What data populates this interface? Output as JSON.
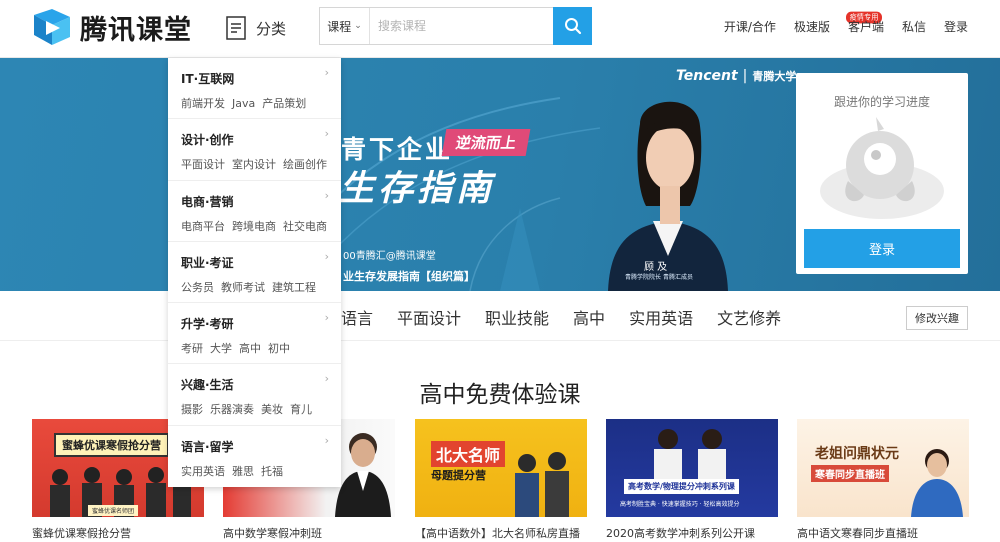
{
  "header": {
    "logo_text": "腾讯课堂",
    "category_label": "分类",
    "search": {
      "type_label": "课程",
      "placeholder": "搜索课程"
    },
    "nav": [
      "开课/合作",
      "极速版",
      "客户端",
      "私信",
      "登录"
    ],
    "nav_badge": "疫情专用"
  },
  "banner": {
    "title_part1": "青下企业",
    "tag": "逆流而上",
    "title_part2": "生存指南",
    "sub1": "00青腾汇@腾讯课堂",
    "sub2": "业生存发展指南【组织篇】",
    "brand": "Tencent",
    "brand_sub": "青腾大学",
    "speaker_name": "顾 及",
    "speaker_title": "青腾学院院长 青腾汇成员"
  },
  "progress": {
    "text": "跟进你的学习进度",
    "login_label": "登录"
  },
  "subjects": [
    "语言",
    "平面设计",
    "职业技能",
    "高中",
    "实用英语",
    "文艺修养"
  ],
  "modify_label": "修改兴趣",
  "section_title": "高中免费体验课",
  "courses": [
    {
      "caption": "蜜蜂优课寒假抢分营",
      "thumb_text": "蜜蜂优课寒假抢分营",
      "thumb_sub": "蜜蜂优课名师团"
    },
    {
      "caption": "高中数学寒假冲刺班",
      "thumb_text": "",
      "thumb_sub": ""
    },
    {
      "caption": "【高中语数外】北大名师私房直播",
      "thumb_text": "北大名师",
      "thumb_sub": "母题提分营"
    },
    {
      "caption": "2020高考数学冲刺系列公开课",
      "thumb_text": "高考数学/物理提分冲刺系列课",
      "thumb_sub": "高考制胜宝典 · 快速掌握技巧 · 轻松高效提分"
    },
    {
      "caption": "高中语文寒春同步直播班",
      "thumb_text": "老姐问鼎状元",
      "thumb_sub": "寒春同步直播班"
    }
  ],
  "dropdown": [
    {
      "title": "IT·互联网",
      "items": [
        "前端开发",
        "Java",
        "产品策划"
      ]
    },
    {
      "title": "设计·创作",
      "items": [
        "平面设计",
        "室内设计",
        "绘画创作"
      ]
    },
    {
      "title": "电商·营销",
      "items": [
        "电商平台",
        "跨境电商",
        "社交电商"
      ]
    },
    {
      "title": "职业·考证",
      "items": [
        "公务员",
        "教师考试",
        "建筑工程"
      ]
    },
    {
      "title": "升学·考研",
      "items": [
        "考研",
        "大学",
        "高中",
        "初中"
      ]
    },
    {
      "title": "兴趣·生活",
      "items": [
        "摄影",
        "乐器演奏",
        "美妆",
        "育儿"
      ]
    },
    {
      "title": "语言·留学",
      "items": [
        "实用英语",
        "雅思",
        "托福"
      ]
    }
  ],
  "colors": {
    "accent": "#23a0e6",
    "banner": "#2a7fab",
    "badge": "#e5332a"
  }
}
